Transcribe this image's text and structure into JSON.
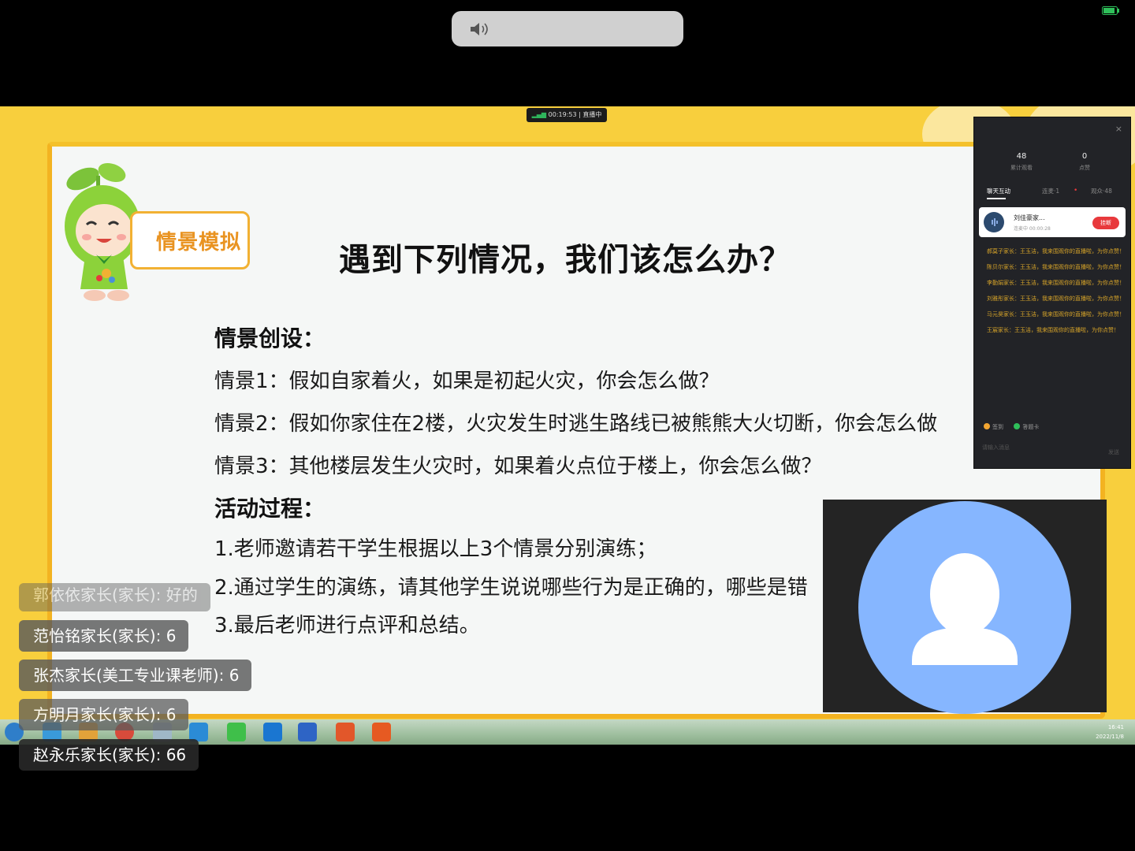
{
  "slide": {
    "badge": "情景模拟",
    "title": "遇到下列情况，我们该怎么办？",
    "section1": "情景创设：",
    "scenario1": "情景1：假如自家着火，如果是初起火灾，你会怎么做？",
    "scenario2": "情景2：假如你家住在2楼，火灾发生时逃生路线已被熊熊大火切断，你会怎么做",
    "scenario3": "情景3：其他楼层发生火灾时，如果着火点位于楼上，你会怎么做？",
    "section2": "活动过程：",
    "step1": "1.老师邀请若干学生根据以上3个情景分别演练；",
    "step2": "2.通过学生的演练，请其他学生说说哪些行为是正确的，哪些是错",
    "step3": "3.最后老师进行点评和总结。"
  },
  "live_tag": {
    "time": "00:19:53",
    "status": "直播中"
  },
  "panel": {
    "close": "×",
    "stat1_value": "48",
    "stat1_label": "累计观看",
    "stat2_value": "0",
    "stat2_label": "点赞",
    "tab_chat": "聊天互动",
    "tab_connect": "连麦·1",
    "tab_audience": "观众·48",
    "caller_name": "刘佳豪家...",
    "caller_time": "连麦中 00:00:28",
    "hangup": "挂断",
    "messages": [
      "郝莫子家长：王玉洁，我来围观你的直播啦，为你点赞！",
      "陈贝尔家长：王玉洁，我来围观你的直播啦，为你点赞！",
      "李勤娟家长：王玉洁，我来围观你的直播啦，为你点赞！",
      "刘雅彤家长：王玉洁，我来围观你的直播啦，为你点赞！",
      "马元昊家长：王玉洁，我来围观你的直播啦，为你点赞！",
      "王宸家长：王玉洁，我来围观你的直播啦，为你点赞！"
    ],
    "signin": "签到",
    "answer_card": "答题卡",
    "input_placeholder": "请输入消息",
    "send": "发送"
  },
  "chat": [
    "郭依依家长(家长): 好的",
    "范怡铭家长(家长): 6",
    "张杰家长(美工专业课老师): 6",
    "方明月家长(家长): 6",
    "赵永乐家长(家长): 66"
  ],
  "taskbar": {
    "time": "16:41",
    "date": "2022/11/8"
  },
  "colors": {
    "stage": "#f8cf3d",
    "accent": "#e99321",
    "avatar": "#86b6ff",
    "hangup": "#e8393c"
  }
}
